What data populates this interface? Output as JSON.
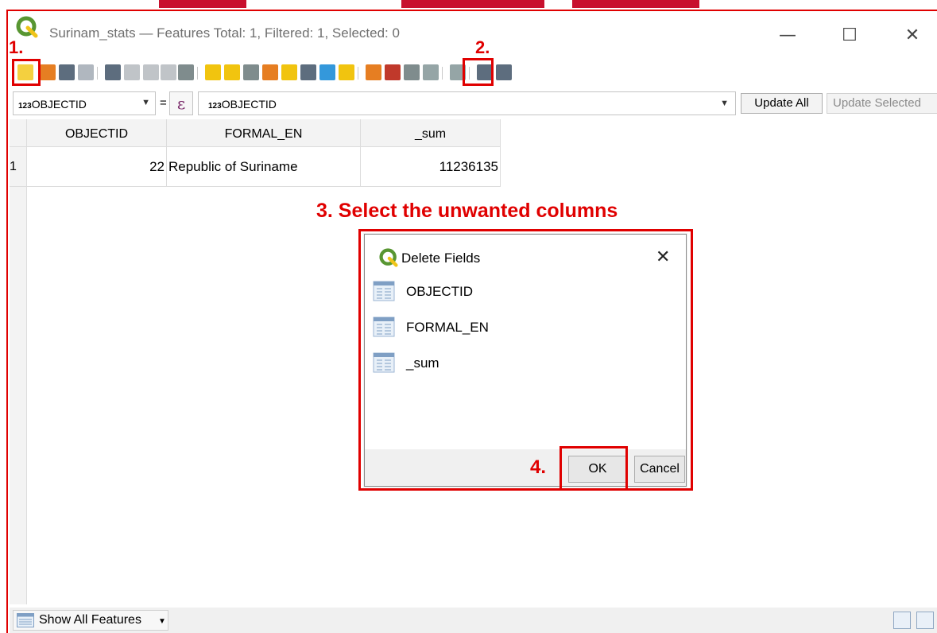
{
  "window": {
    "title": "Surinam_stats — Features Total: 1, Filtered: 1, Selected: 0",
    "minimize_glyph": "—",
    "maximize_glyph": "☐",
    "close_glyph": "✕"
  },
  "toolbar_icons": [
    "toggle-editing-icon",
    "multi-edit-icon",
    "save-edits-icon",
    "reload-icon",
    "add-feature-icon",
    "delete-feature-icon",
    "cut-icon",
    "copy-icon",
    "paste-icon",
    "expression-select-icon",
    "select-all-icon",
    "invert-selection-icon",
    "deselect-all-icon",
    "filter-selected-icon",
    "move-selection-top-icon",
    "pan-to-selected-icon",
    "zoom-to-selected-icon",
    "new-field-icon",
    "delete-field-icon",
    "field-calculator-icon",
    "conditional-formatting-icon",
    "dock-icon",
    "actions-icon",
    "form-icon"
  ],
  "calc_bar": {
    "field_prefix": "123",
    "field_name": "OBJECTID",
    "equals": "=",
    "epsilon": "ε",
    "expr_prefix": "123",
    "expression": "OBJECTID",
    "update_all": "Update All",
    "update_selected": "Update Selected"
  },
  "table": {
    "columns": [
      "OBJECTID",
      "FORMAL_EN",
      "_sum"
    ],
    "rows": [
      {
        "num": "1",
        "cells": [
          "22",
          "Republic of Suriname",
          "11236135"
        ]
      }
    ]
  },
  "annotations": {
    "step1": "1.",
    "step2": "2.",
    "step3": "3. Select the unwanted columns",
    "step4": "4."
  },
  "dialog": {
    "title": "Delete Fields",
    "close_glyph": "✕",
    "fields": [
      "OBJECTID",
      "FORMAL_EN",
      "_sum"
    ],
    "ok_label": "OK",
    "cancel_label": "Cancel"
  },
  "status_bar": {
    "show_features": "Show All Features"
  },
  "colors": {
    "annotation_red": "#e00000",
    "qgis_green": "#589632"
  }
}
